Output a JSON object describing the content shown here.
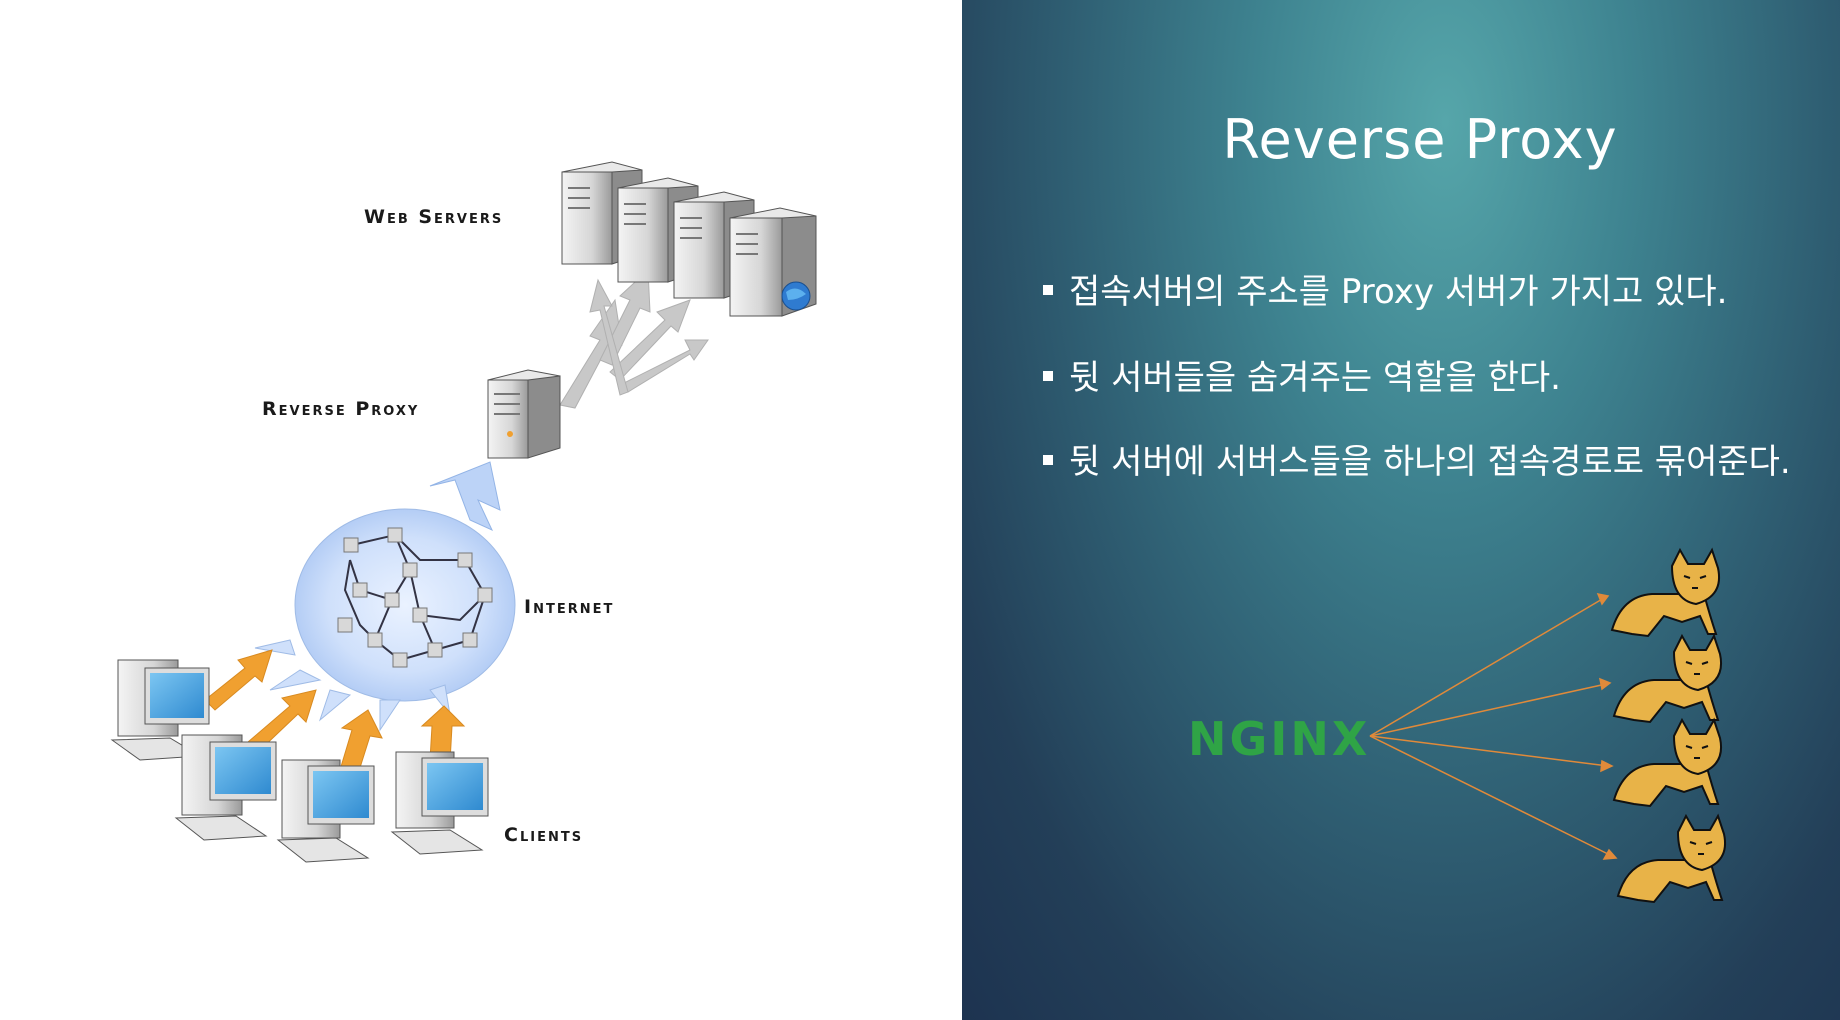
{
  "diagram": {
    "labels": {
      "web_servers": "Web Servers",
      "reverse_proxy": "Reverse Proxy",
      "internet": "Internet",
      "clients": "Clients"
    }
  },
  "slide": {
    "title": "Reverse Proxy",
    "bullets": [
      "접속서버의 주소를 Proxy 서버가 가지고 있다.",
      "뒷 서버들을 숨겨주는 역할을 한다.",
      "뒷 서버에 서버스들을 하나의 접속경로로 묶어준다."
    ],
    "nginx_logo": "NGINX"
  },
  "colors": {
    "arrow_orange": "#f0a030",
    "arrow_gray": "#c8c8c8",
    "nginx_green": "#2fa446",
    "line_orange": "#e08a3a",
    "tomcat_yellow": "#e8b348"
  }
}
